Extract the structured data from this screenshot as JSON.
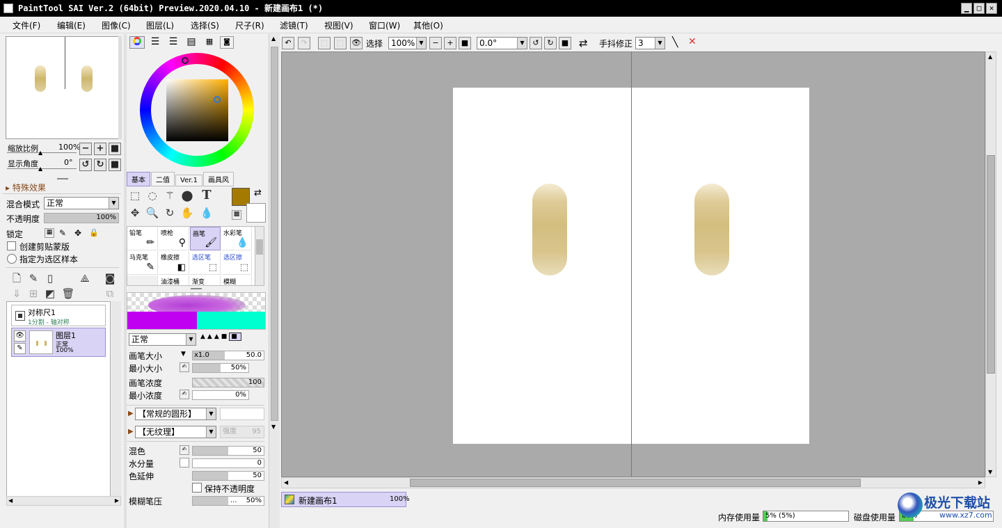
{
  "window": {
    "title": "PaintTool SAI Ver.2 (64bit) Preview.2020.04.10 - 新建画布1 (*)"
  },
  "menu": [
    "文件(F)",
    "编辑(E)",
    "图像(C)",
    "图层(L)",
    "选择(S)",
    "尺子(R)",
    "滤镜(T)",
    "视图(V)",
    "窗口(W)",
    "其他(O)"
  ],
  "navigator": {
    "zoom_label": "缩放比例",
    "zoom_value": "100%",
    "angle_label": "显示角度",
    "angle_value": "0°"
  },
  "layer_panel": {
    "effects_header": "特殊效果",
    "blend_label": "混合模式",
    "blend_value": "正常",
    "opacity_label": "不透明度",
    "opacity_value": "100%",
    "lock_label": "锁定",
    "clip_label": "创建剪贴蒙版",
    "sample_label": "指定为选区样本",
    "layers": [
      {
        "name": "对称尺1",
        "sub": "1分割 - 轴对称"
      },
      {
        "name": "图层1",
        "mode": "正常",
        "opacity": "100%"
      }
    ]
  },
  "color_tabs": [
    "基本",
    "二值",
    "Ver.1",
    "画具风"
  ],
  "colors": {
    "primary": "#a47b00",
    "secondary": "#ffffff",
    "accent": "#c9b5e8"
  },
  "brushes": [
    {
      "name": "铅笔"
    },
    {
      "name": "喷枪"
    },
    {
      "name": "画笔"
    },
    {
      "name": "水彩笔"
    },
    {
      "name": "马克笔"
    },
    {
      "name": "橡皮擦"
    },
    {
      "name": "选区笔"
    },
    {
      "name": "选区擦"
    },
    {
      "name": ""
    },
    {
      "name": "油漆桶"
    },
    {
      "name": "渐变"
    },
    {
      "name": "模糊"
    }
  ],
  "brush_settings": {
    "mode": "正常",
    "size_label": "画笔大小",
    "size_mult": "x1.0",
    "size_value": "50.0",
    "min_size_label": "最小大小",
    "min_size_value": "50%",
    "density_label": "画笔浓度",
    "density_value": "100",
    "min_density_label": "最小浓度",
    "min_density_value": "0%",
    "shape": "【常规的圆形】",
    "texture": "【无纹理】",
    "texture_strength": "强度",
    "texture_value": "95",
    "blend_label": "混色",
    "blend_value": "50",
    "water_label": "水分量",
    "water_value": "0",
    "color_ext_label": "色延伸",
    "color_ext_value": "50",
    "keep_opacity_label": "保持不透明度",
    "blur_label": "模糊笔压",
    "blur_value": "50%"
  },
  "toolbar": {
    "select_label": "选择",
    "zoom": "100%",
    "angle": "0.0°",
    "stabilizer_label": "手抖修正",
    "stabilizer_value": "3"
  },
  "canvas_tab": {
    "name": "新建画布1",
    "zoom": "100%"
  },
  "status": {
    "mem_label": "内存使用量",
    "mem_value": "5% (5%)",
    "disk_label": "磁盘使用量",
    "disk_value": "88%"
  },
  "watermark": {
    "name": "极光下载站",
    "url": "www.xz7.com"
  }
}
